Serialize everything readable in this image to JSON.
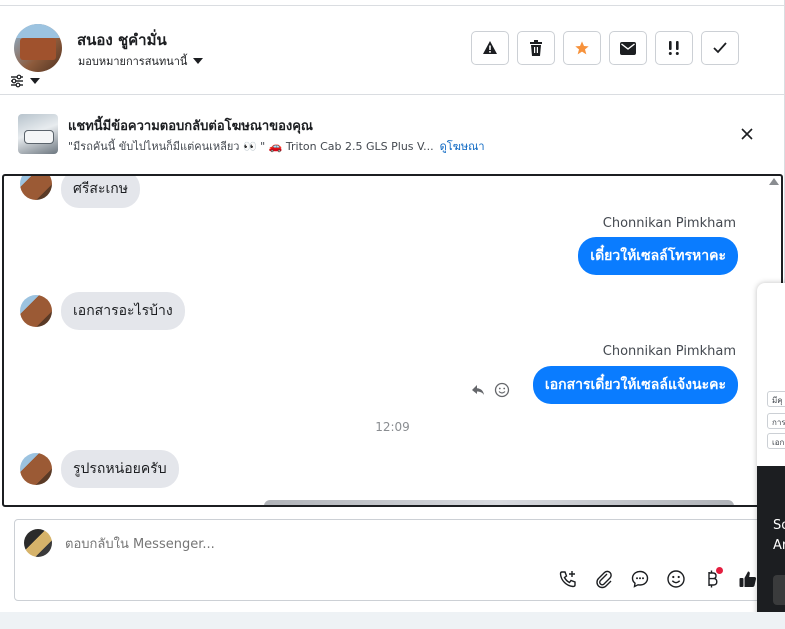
{
  "header": {
    "contact_name": "สนอง ชูคำมั่น",
    "assign_label": "มอบหมายการสนทนานี้",
    "actions": [
      {
        "name": "report-button",
        "icon": "warning-icon"
      },
      {
        "name": "delete-button",
        "icon": "trash-icon"
      },
      {
        "name": "star-button",
        "icon": "star-icon"
      },
      {
        "name": "mark-unread-button",
        "icon": "envelope-icon"
      },
      {
        "name": "follow-up-button",
        "icon": "exclamation-icon"
      },
      {
        "name": "mark-done-button",
        "icon": "check-icon"
      }
    ],
    "star_color": "#f7923b"
  },
  "ad_banner": {
    "title": "แชทนี้มีข้อความตอบกลับต่อโฆษณาของคุณ",
    "subtitle": "\"มีรถคันนี้ ขับไปไหนก็มีแต่คนเหลียว 👀 \" 🚗 Triton Cab 2.5 GLS Plus V...",
    "link": "ดูโฆษณา"
  },
  "messages": {
    "m1": "ศรีสะเกษ",
    "sender1": "Chonnikan Pimkham",
    "m2": "เดี๋ยวให้เซลล์โทรหาคะ",
    "m3": "เอกสารอะไรบ้าง",
    "sender2": "Chonnikan Pimkham",
    "m4": "เอกสารเดี๋ยวให้เซลล์แจ้งนะคะ",
    "time": "12:09",
    "m5": "รูปรถหน่อยครับ"
  },
  "composer": {
    "placeholder": "ตอบกลับใน Messenger..."
  },
  "overlay": {
    "chip1": "มีคุ",
    "chip2": "การ",
    "chip3": "เอก",
    "line1": "So",
    "line2": "Ar"
  },
  "colors": {
    "outgoing_bubble": "#0a7cff",
    "incoming_bubble": "#e4e6eb",
    "link": "#0a66c2"
  }
}
